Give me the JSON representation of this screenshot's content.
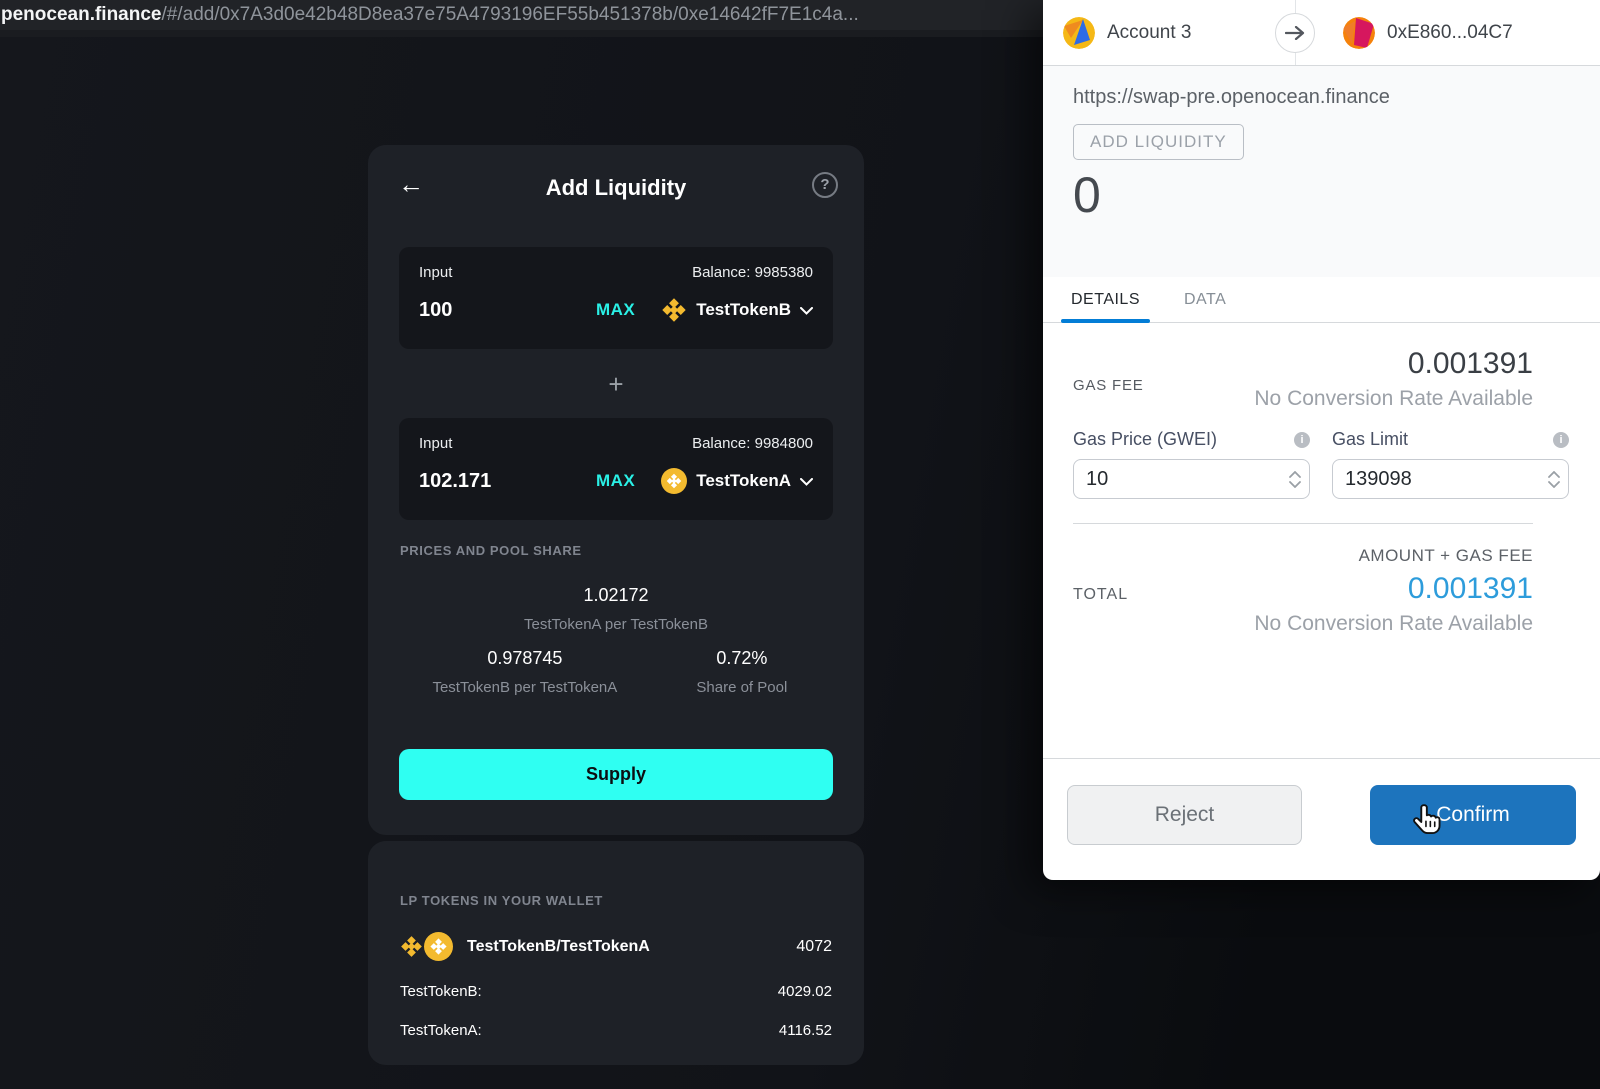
{
  "browser": {
    "url_domain": "penocean.finance",
    "url_path": "/#/add/0x7A3d0e42b48D8ea37e75A4793196EF55b451378b/0xe14642fF7E1c4a..."
  },
  "add_liquidity": {
    "title": "Add Liquidity",
    "help_icon": "?",
    "back_icon": "←",
    "plus_icon": "+",
    "input_top": {
      "label": "Input",
      "balance": "Balance: 9985380",
      "value": "100",
      "max_label": "MAX",
      "token": "TestTokenB"
    },
    "input_bottom": {
      "label": "Input",
      "balance": "Balance: 9984800",
      "value": "102.171",
      "max_label": "MAX",
      "token": "TestTokenA"
    },
    "prices_heading": "PRICES AND POOL SHARE",
    "price_main": {
      "value": "1.02172",
      "label": "TestTokenA per TestTokenB"
    },
    "price_secondary": {
      "value": "0.978745",
      "label": "TestTokenB per TestTokenA"
    },
    "pool_share": {
      "value": "0.72%",
      "label": "Share of Pool"
    },
    "supply_label": "Supply"
  },
  "lp_wallet": {
    "heading": "LP TOKENS IN YOUR WALLET",
    "pair": {
      "name": "TestTokenB/TestTokenA",
      "amount": "4072"
    },
    "rows": [
      {
        "label": "TestTokenB:",
        "value": "4029.02"
      },
      {
        "label": "TestTokenA:",
        "value": "4116.52"
      }
    ]
  },
  "wallet_popup": {
    "from_account": "Account 3",
    "to_account": "0xE860...04C7",
    "origin": "https://swap-pre.openocean.finance",
    "method_badge": "ADD LIQUIDITY",
    "amount": "0",
    "tabs": {
      "details": "DETAILS",
      "data": "DATA"
    },
    "gas_fee": {
      "label": "GAS FEE",
      "value": "0.001391",
      "note": "No Conversion Rate Available"
    },
    "gas_price": {
      "label": "Gas Price (GWEI)",
      "value": "10",
      "info_icon": "i"
    },
    "gas_limit": {
      "label": "Gas Limit",
      "value": "139098",
      "info_icon": "i"
    },
    "total": {
      "caption": "AMOUNT + GAS FEE",
      "label": "TOTAL",
      "value": "0.001391",
      "note": "No Conversion Rate Available"
    },
    "reject_label": "Reject",
    "confirm_label": "Confirm"
  },
  "colors": {
    "accent_cyan": "#2ffff2",
    "binance_gold": "#f3ba2f",
    "tab_underline_blue": "#037dd6",
    "total_blue": "#2d9cdb",
    "confirm_blue": "#1d74bd",
    "card_bg": "#1e2127",
    "input_bg": "#14161b",
    "popup_section_bg": "#f9fafb"
  }
}
